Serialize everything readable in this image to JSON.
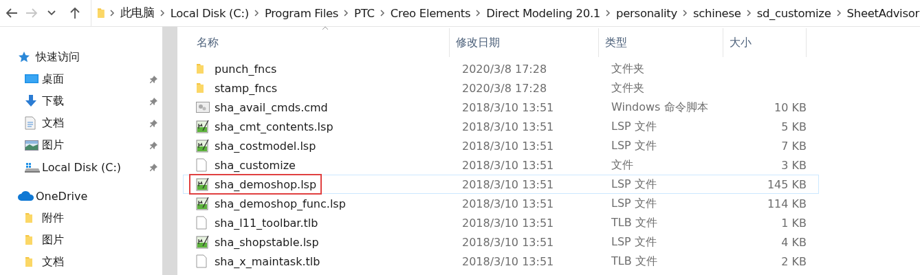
{
  "nav": [
    {
      "kind": "back",
      "disabled": false
    },
    {
      "kind": "forward",
      "disabled": true
    },
    {
      "kind": "recent",
      "disabled": false
    },
    {
      "kind": "up",
      "disabled": false
    }
  ],
  "breadcrumb": [
    "此电脑",
    "Local Disk (C:)",
    "Program Files",
    "PTC",
    "Creo Elements",
    "Direct Modeling 20.1",
    "personality",
    "schinese",
    "sd_customize",
    "SheetAdvisor"
  ],
  "sidebar": {
    "items": [
      {
        "label": "快速访问",
        "kind": "quick-access",
        "children": [
          {
            "label": "桌面",
            "kind": "desktop",
            "pinned": true
          },
          {
            "label": "下载",
            "kind": "download",
            "pinned": true
          },
          {
            "label": "文档",
            "kind": "documents",
            "pinned": true
          },
          {
            "label": "图片",
            "kind": "pictures",
            "pinned": true
          },
          {
            "label": "Local Disk (C:)",
            "kind": "disk",
            "pinned": true
          }
        ]
      },
      {
        "label": "OneDrive",
        "kind": "onedrive",
        "children": [
          {
            "label": "附件",
            "kind": "folder",
            "pinned": false
          },
          {
            "label": "图片",
            "kind": "folder",
            "pinned": false
          },
          {
            "label": "文档",
            "kind": "folder",
            "pinned": false
          }
        ]
      }
    ]
  },
  "table": {
    "columns": [
      "名称",
      "修改日期",
      "类型",
      "大小"
    ],
    "rows": [
      {
        "kind": "folder",
        "name": "punch_fncs",
        "date": "2020/3/8 17:28",
        "type": "文件夹",
        "selected": false,
        "annotated": false
      },
      {
        "kind": "folder",
        "name": "stamp_fncs",
        "date": "2020/3/8 17:28",
        "type": "文件夹",
        "selected": false,
        "annotated": false
      },
      {
        "kind": "cmd",
        "name": "sha_avail_cmds.cmd",
        "date": "2018/3/10 13:51",
        "type": "Windows 命令脚本",
        "size": "10 KB",
        "selected": false,
        "annotated": false
      },
      {
        "kind": "lsp",
        "name": "sha_cmt_contents.lsp",
        "date": "2018/3/10 13:51",
        "type": "LSP 文件",
        "size": "5 KB",
        "selected": false,
        "annotated": false
      },
      {
        "kind": "lsp",
        "name": "sha_costmodel.lsp",
        "date": "2018/3/10 13:51",
        "type": "LSP 文件",
        "size": "7 KB",
        "selected": false,
        "annotated": false
      },
      {
        "kind": "file",
        "name": "sha_customize",
        "date": "2018/3/10 13:51",
        "type": "文件",
        "size": "3 KB",
        "selected": false,
        "annotated": false
      },
      {
        "kind": "lsp",
        "name": "sha_demoshop.lsp",
        "date": "2018/3/10 13:51",
        "type": "LSP 文件",
        "size": "145 KB",
        "selected": true,
        "annotated": true
      },
      {
        "kind": "lsp",
        "name": "sha_demoshop_func.lsp",
        "date": "2018/3/10 13:51",
        "type": "LSP 文件",
        "size": "114 KB",
        "selected": false,
        "annotated": false
      },
      {
        "kind": "file",
        "name": "sha_l11_toolbar.tlb",
        "date": "2018/3/10 13:51",
        "type": "TLB 文件",
        "size": "1 KB",
        "selected": false,
        "annotated": false
      },
      {
        "kind": "lsp",
        "name": "sha_shopstable.lsp",
        "date": "2018/3/10 13:51",
        "type": "LSP 文件",
        "size": "4 KB",
        "selected": false,
        "annotated": false
      },
      {
        "kind": "file",
        "name": "sha_x_maintask.tlb",
        "date": "2018/3/10 13:51",
        "type": "TLB 文件",
        "size": "2 KB",
        "selected": false,
        "annotated": false
      }
    ]
  }
}
